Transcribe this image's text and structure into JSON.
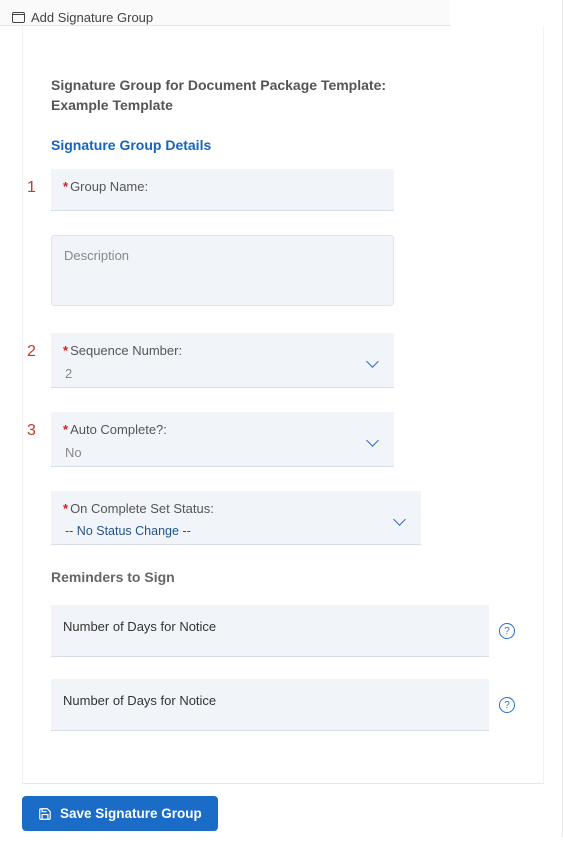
{
  "window": {
    "title": "Add Signature Group"
  },
  "header": {
    "title_line1": "Signature Group for Document Package Template:",
    "title_line2": "Example Template",
    "section": "Signature Group Details"
  },
  "annotations": {
    "n1": "1",
    "n2": "2",
    "n3": "3"
  },
  "fields": {
    "group_name": {
      "label": "Group Name:"
    },
    "description": {
      "placeholder": "Description"
    },
    "sequence": {
      "label": "Sequence Number:",
      "value": "2"
    },
    "auto_complete": {
      "label": "Auto Complete?:",
      "value": "No"
    },
    "on_complete": {
      "label": "On Complete Set Status:",
      "value": "-- No Status Change --"
    }
  },
  "reminders": {
    "title": "Reminders to Sign",
    "notice1": {
      "label": "Number of Days for Notice"
    },
    "notice2": {
      "label": "Number of Days for Notice"
    }
  },
  "actions": {
    "save": "Save Signature Group"
  }
}
